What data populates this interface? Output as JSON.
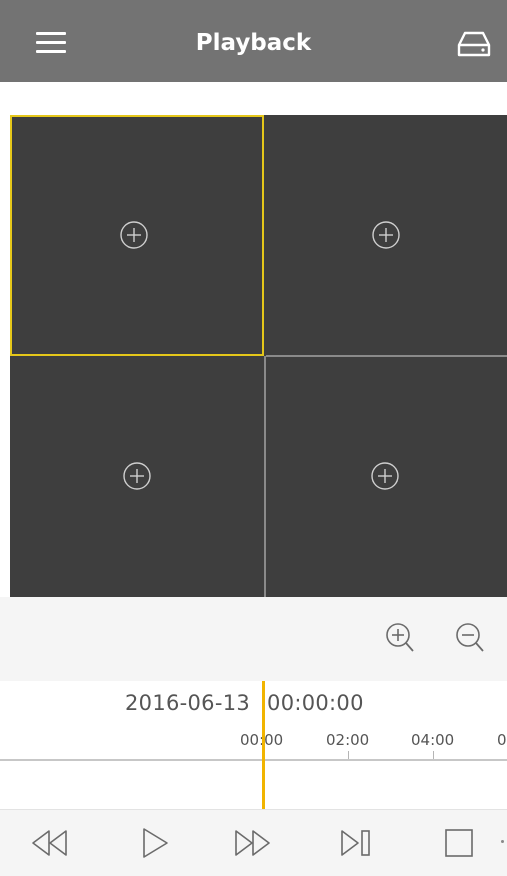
{
  "header": {
    "title": "Playback",
    "menu_icon": "hamburger-menu-icon",
    "storage_icon": "hard-drive-icon",
    "background": "#737373"
  },
  "video_grid": {
    "cells": [
      {
        "selected": true,
        "icon": "add-channel-icon"
      },
      {
        "selected": false,
        "icon": "add-channel-icon"
      },
      {
        "selected": false,
        "icon": "add-channel-icon"
      },
      {
        "selected": false,
        "icon": "add-channel-icon"
      }
    ],
    "selected_border_color": "#e5c71a",
    "cell_background": "#3e3e3e"
  },
  "zoom": {
    "zoom_in_icon": "zoom-in-icon",
    "zoom_out_icon": "zoom-out-icon"
  },
  "timeline": {
    "date": "2016-06-13",
    "time": "00:00:00",
    "ticks": [
      "00:00",
      "02:00",
      "04:00",
      "0"
    ],
    "cursor_color": "#f1b400"
  },
  "controls": {
    "buttons": [
      "rewind-icon",
      "play-icon",
      "fast-forward-icon",
      "next-frame-icon",
      "stop-icon"
    ]
  }
}
